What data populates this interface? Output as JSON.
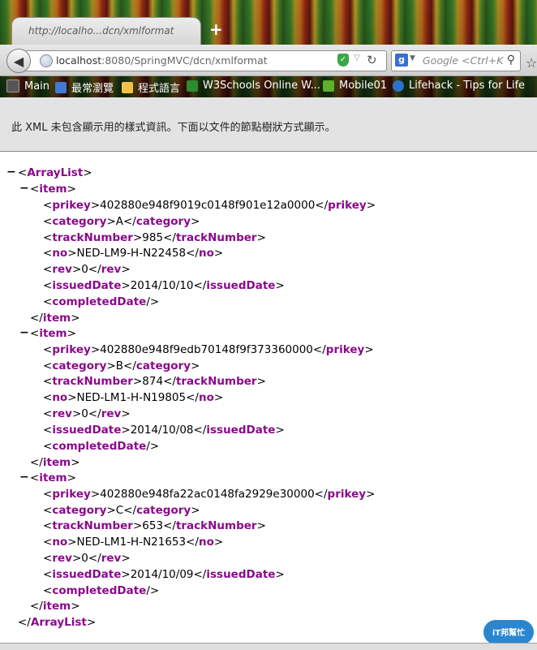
{
  "browser": {
    "tab_title": "http://localho...dcn/xmlformat",
    "new_tab": "+",
    "url_host": "localhost",
    "url_rest": ":8080/SpringMVC/dcn/xmlformat",
    "search_placeholder": "Google <Ctrl+K",
    "search_engine": "g"
  },
  "bookmarks": [
    {
      "label": "Main",
      "icon": "bookmark-folder-icon",
      "color": "#5a5a5a"
    },
    {
      "label": "最常瀏覽",
      "icon": "magnifier-icon",
      "color": "#3d7bd6"
    },
    {
      "label": "程式語言",
      "icon": "folder-icon",
      "color": "#f0c24a"
    },
    {
      "label": "W3Schools Online W...",
      "icon": "w3schools-icon",
      "color": "#2e8b2e"
    },
    {
      "label": "Mobile01",
      "icon": "mobile01-icon",
      "color": "#5cb02c"
    },
    {
      "label": "Lifehack - Tips for Life",
      "icon": "lifehack-icon",
      "color": "#2a73c9"
    }
  ],
  "infobar": {
    "message": "此 XML 未包含顯示用的樣式資訊。下面以文件的節點樹狀方式顯示。"
  },
  "xml": {
    "root": "ArrayList",
    "items": [
      {
        "prikey": "402880e948f9019c0148f901e12a0000",
        "category": "A",
        "trackNumber": "985",
        "no": "NED-LM9-H-N22458",
        "rev": "0",
        "issuedDate": "2014/10/10"
      },
      {
        "prikey": "402880e948f9edb70148f9f373360000",
        "category": "B",
        "trackNumber": "874",
        "no": "NED-LM1-H-N19805",
        "rev": "0",
        "issuedDate": "2014/10/08"
      },
      {
        "prikey": "402880e948fa22ac0148fa2929e30000",
        "category": "C",
        "trackNumber": "653",
        "no": "NED-LM1-H-N21653",
        "rev": "0",
        "issuedDate": "2014/10/09"
      }
    ]
  },
  "watermark": {
    "text": "iT邦",
    "sub": "幫忙"
  }
}
